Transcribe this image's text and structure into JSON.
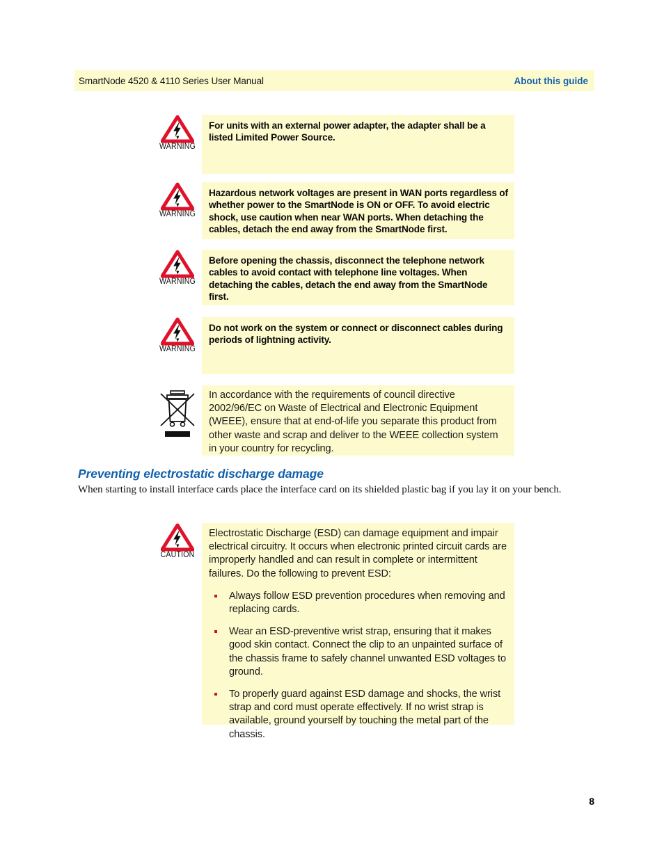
{
  "header": {
    "left_text": "SmartNode 4520 & 4110 Series User Manual",
    "right_text": "About this guide",
    "background": "#fdfbcd",
    "right_color": "#1161ad"
  },
  "admonitions": [
    {
      "label": "WARNING",
      "icon": "warning-triangle-lightning-icon",
      "text": "For units with an external power adapter, the adapter shall be a listed Limited Power Source."
    },
    {
      "label": "WARNING",
      "icon": "warning-triangle-lightning-icon",
      "text": "Hazardous network voltages are present in WAN ports regardless of whether power to the SmartNode is ON or OFF. To avoid electric shock, use caution when near WAN ports. When detaching the cables, detach the end away from the SmartNode first."
    },
    {
      "label": "WARNING",
      "icon": "warning-triangle-lightning-icon",
      "text": "Before opening the chassis, disconnect the telephone network cables to avoid contact with telephone line voltages. When detaching the cables, detach the end away from the SmartNode first."
    },
    {
      "label": "WARNING",
      "icon": "warning-triangle-lightning-icon",
      "text": "Do not work on the system or connect or disconnect cables during periods of lightning activity."
    },
    {
      "label": "",
      "icon": "weee-crossed-out-wheelie-bin-icon",
      "text": "In accordance with the requirements of council directive 2002/96/EC on Waste of Electrical and Electronic Equipment (WEEE), ensure that at end-of-life you separate this product from other waste and scrap and deliver to the WEEE collection system in your country for recycling."
    }
  ],
  "section": {
    "heading": "Preventing electrostatic discharge damage",
    "body": "When starting to install interface cards place the interface card on its shielded plastic bag if you lay it on your bench."
  },
  "caution": {
    "label": "CAUTION",
    "icon": "caution-triangle-lightning-icon",
    "intro": "Electrostatic Discharge (ESD) can damage equipment and impair electrical circuitry. It occurs when electronic printed circuit cards are improperly handled and can result in complete or intermittent failures. Do the following to prevent ESD:",
    "bullets": [
      "Always follow ESD prevention procedures when removing and replacing cards.",
      "Wear an ESD-preventive wrist strap, ensuring that it makes good skin contact. Connect the clip to an unpainted surface of the chassis frame to safely channel unwanted ESD voltages to ground.",
      "To properly guard against ESD damage and shocks, the wrist strap and cord must operate effectively. If no wrist strap is available, ground yourself by touching the metal part of the chassis."
    ]
  },
  "footer": {
    "page_number": "8"
  },
  "colors": {
    "admonition_background": "#fdfbcd",
    "accent_blue": "#1161ad",
    "warning_red": "#e0112b",
    "bullet_red": "#c8102e"
  }
}
